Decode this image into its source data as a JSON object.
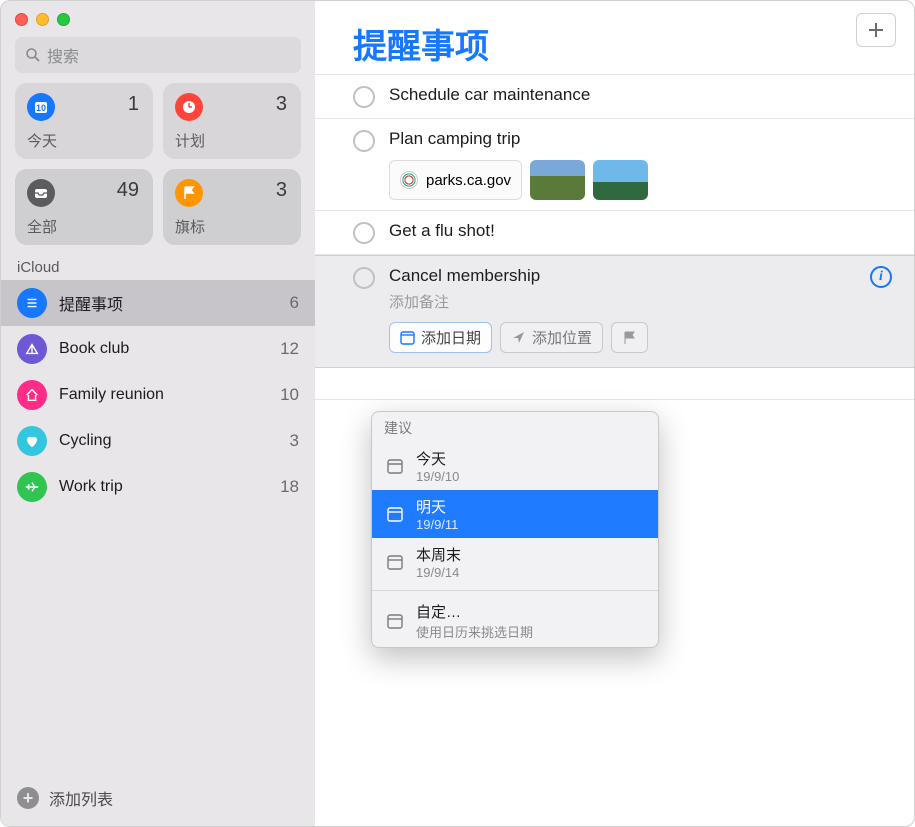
{
  "search": {
    "placeholder": "搜索"
  },
  "tiles": [
    {
      "label": "今天",
      "count": "1",
      "color": "#1677ff",
      "icon": "calendar"
    },
    {
      "label": "计划",
      "count": "3",
      "color": "#ff453a",
      "icon": "clock"
    },
    {
      "label": "全部",
      "count": "49",
      "color": "#5b5b60",
      "icon": "tray"
    },
    {
      "label": "旗标",
      "count": "3",
      "color": "#ff9500",
      "icon": "flag"
    }
  ],
  "section": "iCloud",
  "lists": [
    {
      "name": "提醒事项",
      "count": "6",
      "color": "#1677ff",
      "icon": "list",
      "selected": true
    },
    {
      "name": "Book club",
      "count": "12",
      "color": "#6f58d6",
      "icon": "tent"
    },
    {
      "name": "Family reunion",
      "count": "10",
      "color": "#ff2d87",
      "icon": "house"
    },
    {
      "name": "Cycling",
      "count": "3",
      "color": "#34c6de",
      "icon": "heart"
    },
    {
      "name": "Work trip",
      "count": "18",
      "color": "#30c552",
      "icon": "plane"
    }
  ],
  "addList": "添加列表",
  "main": {
    "title": "提醒事项",
    "reminders": [
      {
        "title": "Schedule car maintenance"
      },
      {
        "title": "Plan camping trip",
        "link": "parks.ca.gov"
      },
      {
        "title": "Get a flu shot!"
      },
      {
        "title": "Cancel membership",
        "notes": "添加备注",
        "editing": true
      }
    ],
    "editButtons": {
      "date": "添加日期",
      "location": "添加位置"
    }
  },
  "popover": {
    "header": "建议",
    "items": [
      {
        "title": "今天",
        "sub": "19/9/10"
      },
      {
        "title": "明天",
        "sub": "19/9/11",
        "selected": true
      },
      {
        "title": "本周末",
        "sub": "19/9/14"
      }
    ],
    "custom": {
      "title": "自定…",
      "sub": "使用日历来挑选日期"
    }
  }
}
